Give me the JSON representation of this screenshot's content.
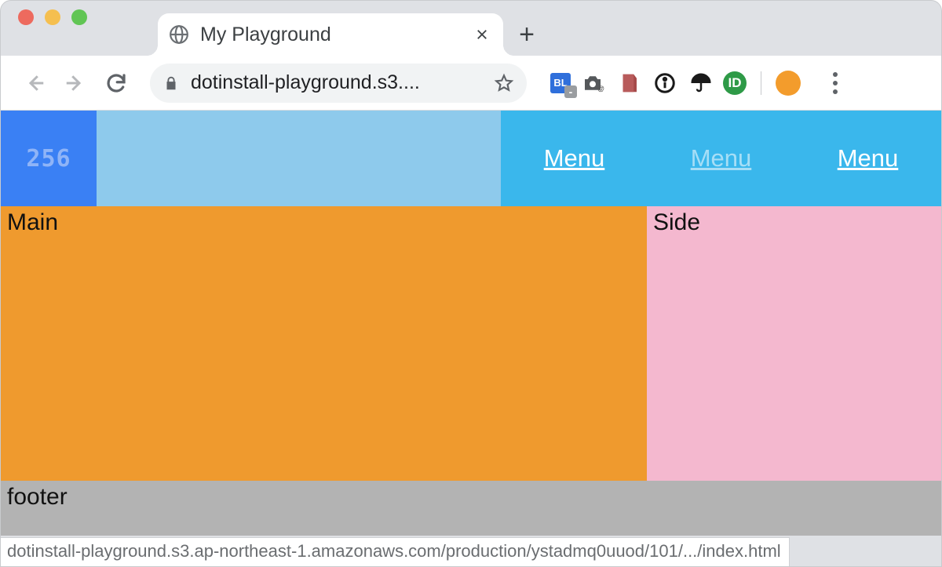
{
  "browser": {
    "tab_title": "My Playground",
    "url_display": "dotinstall-playground.s3....",
    "status_bar": "dotinstall-playground.s3.ap-northeast-1.amazonaws.com/production/ystadmq0uuod/101/.../index.html",
    "extension_bl_label": "BL",
    "extension_id_label": "ID"
  },
  "page": {
    "logo_text": "256",
    "nav": {
      "items": [
        {
          "label": "Menu"
        },
        {
          "label": "Menu"
        },
        {
          "label": "Menu"
        }
      ]
    },
    "main_label": "Main",
    "side_label": "Side",
    "footer_label": "footer"
  }
}
